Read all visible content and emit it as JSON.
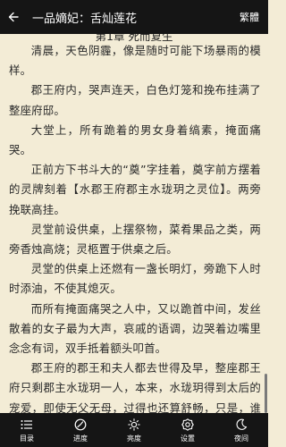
{
  "header": {
    "title": "一品嫡妃：舌灿莲花",
    "traditional_label": "繁體"
  },
  "chapter": {
    "title": "第1章 死而复生",
    "paragraphs": [
      "清晨，天色阴霾，像是随时可能下场暴雨的模样。",
      "郡王府内，哭声连天，白色灯笼和挽布挂满了整座府邸。",
      "大堂上，所有跪着的男女身着缟素，掩面痛哭。",
      "正前方下书斗大的“奠”字挂着，奠字前方摆着的灵牌刻着【水郡王府郡主水珑玥之灵位】。两旁挽联高挂。",
      "灵堂前设供桌，上摆祭物，菜肴果品之类，两旁香烛高烧；灵柩置于供桌之后。",
      "灵堂的供桌上还燃有一盏长明灯，旁跪下人时时添油，不使其熄灭。",
      "而所有掩面痛哭之人中，又以跪首中间，发丝散着的女子最为大声，哀戚的语调，边哭着边嘴里念念有词，双手抵着额头叩首。",
      "郡王府的郡王和夫人都去世得及早，整座郡王府只剩郡主水珑玥一人，本来，水珑玥得到太后的宠爱，即使无父无母，过得也还算舒畅，只是，谁知，太后刚仙逝未满一个月，这郡主便出事了。"
    ]
  },
  "bottom_nav": {
    "items": [
      {
        "label": "目录",
        "icon": "list-icon"
      },
      {
        "label": "进度",
        "icon": "progress-icon"
      },
      {
        "label": "亮度",
        "icon": "brightness-icon"
      },
      {
        "label": "设置",
        "icon": "gear-icon"
      },
      {
        "label": "夜间",
        "icon": "moon-icon"
      }
    ]
  },
  "colors": {
    "bar_background": "#151515",
    "page_background": "#f3ecd6",
    "text": "#2a2a2a"
  }
}
